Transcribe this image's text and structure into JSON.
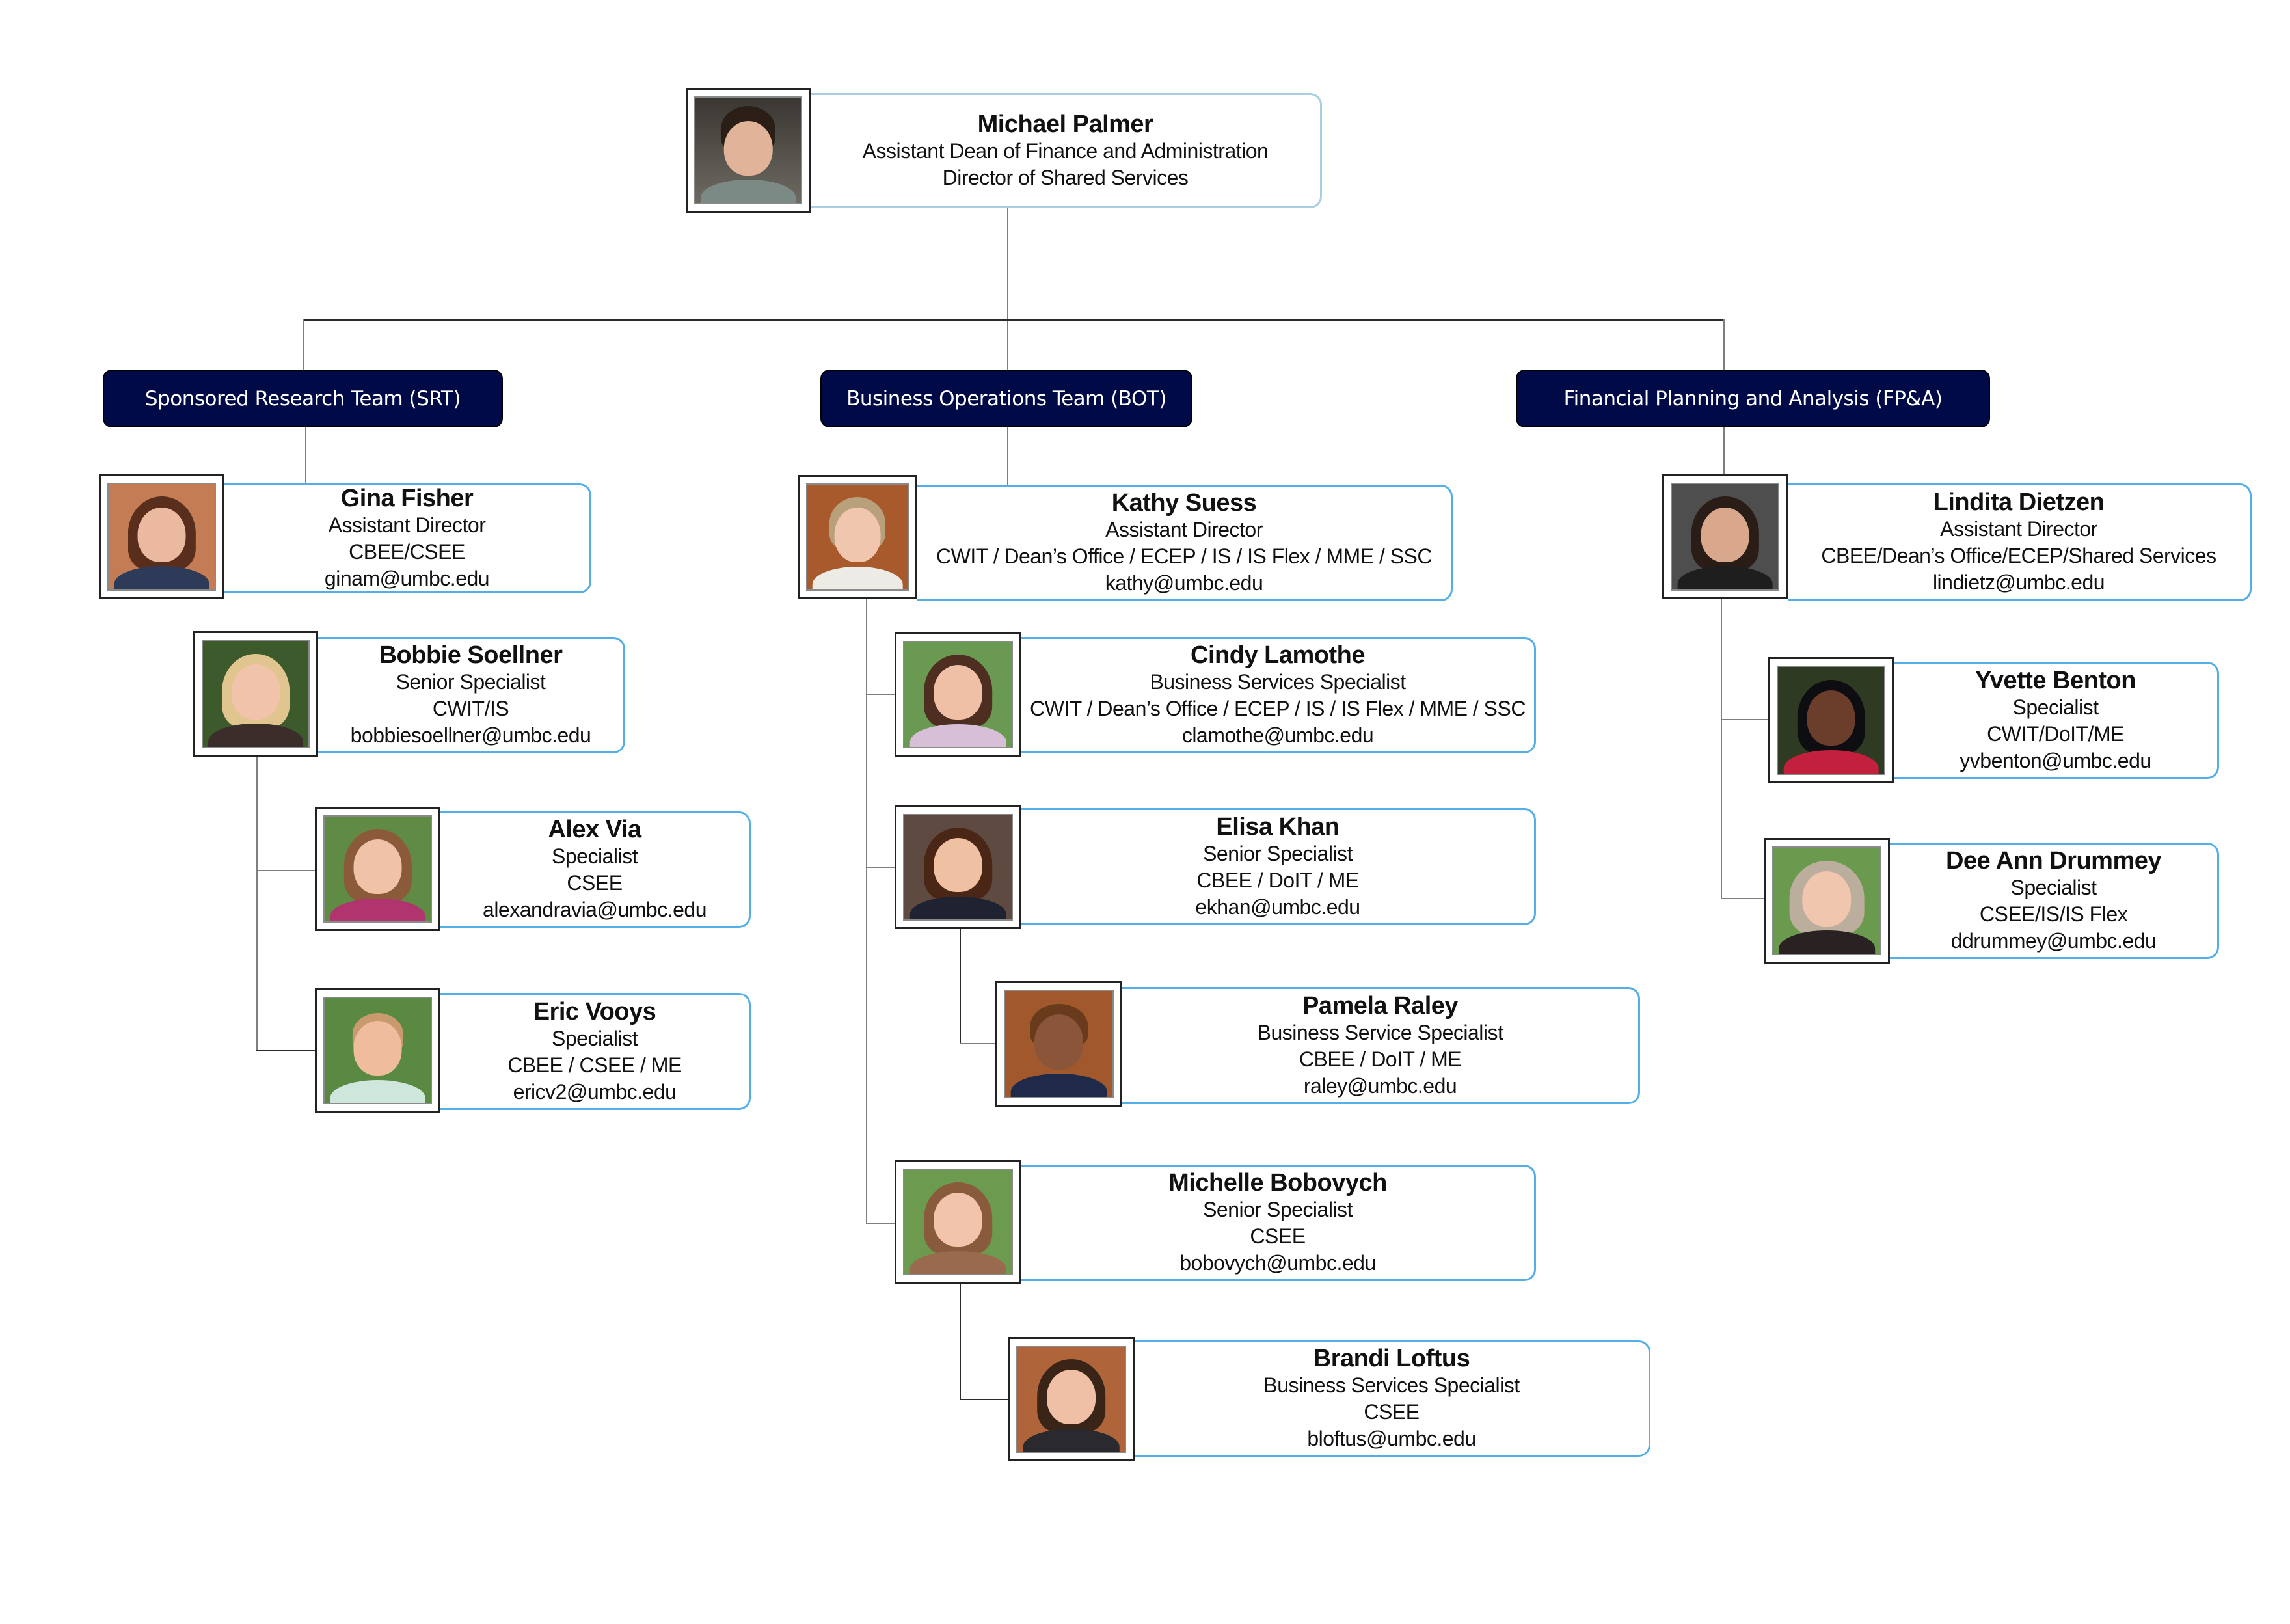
{
  "chart": "Shared Services Organization Chart",
  "colors": {
    "team_header_bg": "#000a46",
    "card_border": "#54aee8",
    "top_card_border": "#a9cde2",
    "connector": "#7f7f7f"
  },
  "director": {
    "name": "Michael Palmer",
    "title": "Assistant Dean of Finance and Administration",
    "subtitle": "Director of Shared Services",
    "photo": "portrait-photo"
  },
  "teams": [
    {
      "label": "Sponsored Research Team (SRT)",
      "members": [
        {
          "name": "Gina Fisher",
          "title": "Assistant Director",
          "units": "CBEE/CSEE",
          "email": "ginam@umbc.edu",
          "reports_to": "Michael Palmer"
        },
        {
          "name": "Bobbie Soellner",
          "title": "Senior Specialist",
          "units": "CWIT/IS",
          "email": "bobbiesoellner@umbc.edu",
          "reports_to": "Gina Fisher"
        },
        {
          "name": "Alex Via",
          "title": "Specialist",
          "units": "CSEE",
          "email": "alexandravia@umbc.edu",
          "reports_to": "Bobbie Soellner"
        },
        {
          "name": "Eric Vooys",
          "title": "Specialist",
          "units": "CBEE / CSEE / ME",
          "email": "ericv2@umbc.edu",
          "reports_to": "Bobbie Soellner"
        }
      ]
    },
    {
      "label": "Business Operations Team (BOT)",
      "members": [
        {
          "name": "Kathy Suess",
          "title": "Assistant Director",
          "units": "CWIT / Dean’s Office / ECEP / IS / IS Flex / MME / SSC",
          "email": "kathy@umbc.edu",
          "reports_to": "Michael Palmer"
        },
        {
          "name": "Cindy Lamothe",
          "title": "Business Services Specialist",
          "units": "CWIT / Dean’s Office / ECEP / IS / IS Flex / MME / SSC",
          "email": "clamothe@umbc.edu",
          "reports_to": "Kathy Suess"
        },
        {
          "name": "Elisa Khan",
          "title": "Senior Specialist",
          "units": "CBEE / DoIT / ME",
          "email": "ekhan@umbc.edu",
          "reports_to": "Kathy Suess"
        },
        {
          "name": "Pamela Raley",
          "title": "Business Service Specialist",
          "units": "CBEE / DoIT / ME",
          "email": "raley@umbc.edu",
          "reports_to": "Elisa Khan"
        },
        {
          "name": "Michelle Bobovych",
          "title": "Senior Specialist",
          "units": "CSEE",
          "email": "bobovych@umbc.edu",
          "reports_to": "Kathy Suess"
        },
        {
          "name": "Brandi Loftus",
          "title": "Business Services Specialist",
          "units": "CSEE",
          "email": "bloftus@umbc.edu",
          "reports_to": "Michelle Bobovych"
        }
      ]
    },
    {
      "label": "Financial Planning and Analysis (FP&A)",
      "members": [
        {
          "name": "Lindita Dietzen",
          "title": "Assistant Director",
          "units": "CBEE/Dean’s Office/ECEP/Shared Services",
          "email": "lindietz@umbc.edu",
          "reports_to": "Michael Palmer"
        },
        {
          "name": "Yvette Benton",
          "title": "Specialist",
          "units": "CWIT/DoIT/ME",
          "email": "yvbenton@umbc.edu",
          "reports_to": "Lindita Dietzen"
        },
        {
          "name": "Dee Ann Drummey",
          "title": "Specialist",
          "units": "CSEE/IS/IS Flex",
          "email": "ddrummey@umbc.edu",
          "reports_to": "Lindita Dietzen"
        }
      ]
    }
  ]
}
